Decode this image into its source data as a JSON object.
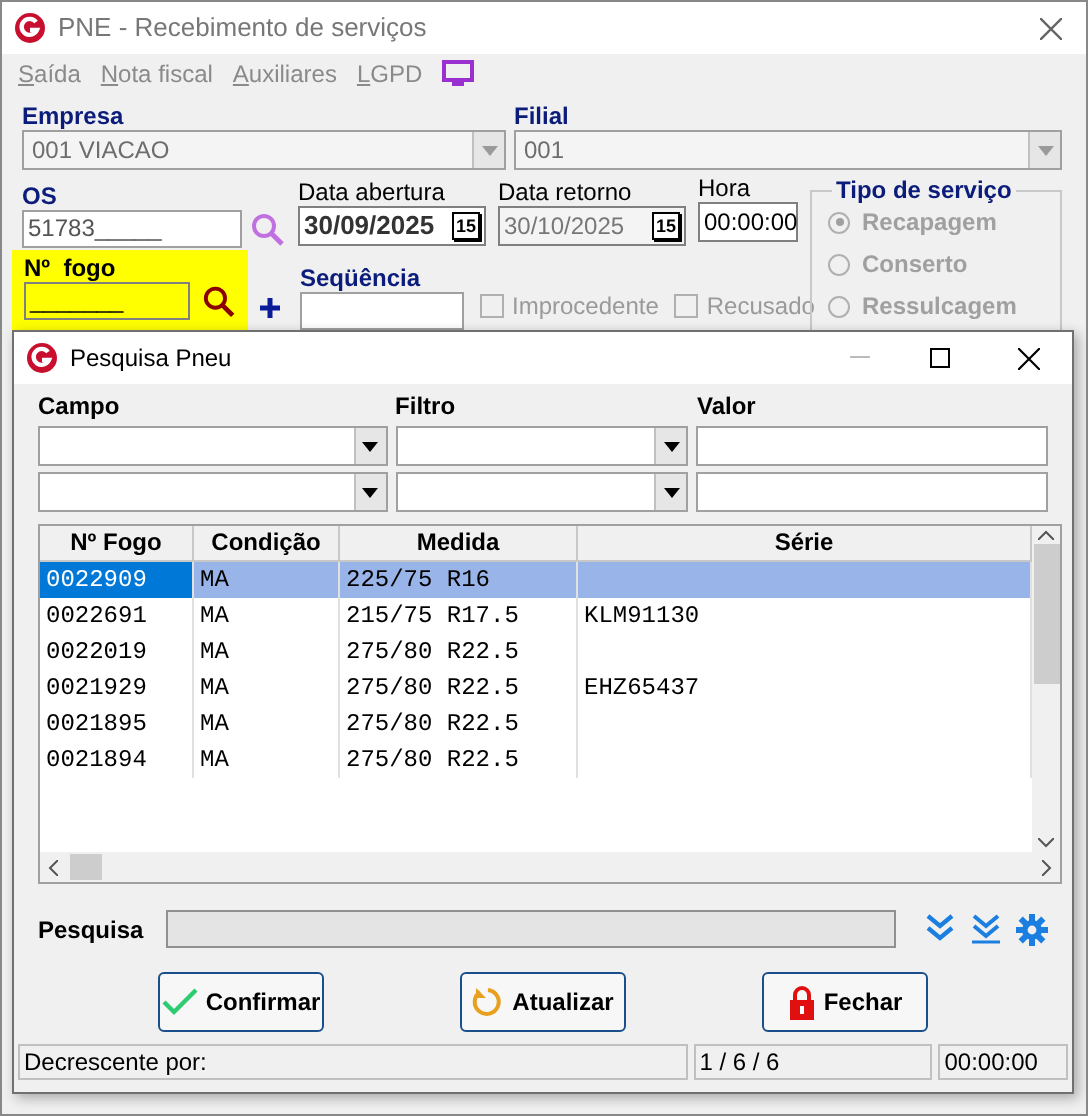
{
  "window": {
    "title": "PNE - Recebimento de serviços"
  },
  "menu": [
    {
      "label": "Saída",
      "disabled": true
    },
    {
      "label": "Nota fiscal",
      "disabled": true
    },
    {
      "label": "Auxiliares",
      "disabled": true
    },
    {
      "label": "LGPD",
      "disabled": true
    }
  ],
  "empresa": {
    "label": "Empresa",
    "value": "001 VIACAO"
  },
  "filial": {
    "label": "Filial",
    "value": "001"
  },
  "os": {
    "label": "OS",
    "value": "51783_____"
  },
  "data_abertura": {
    "label": "Data abertura",
    "value": "30/09/2025",
    "calendar": "15"
  },
  "data_retorno": {
    "label": "Data retorno",
    "value": "30/10/2025",
    "calendar": "15"
  },
  "hora": {
    "label": "Hora",
    "value": "00:00:00"
  },
  "tipo_servico": {
    "title": "Tipo de serviço",
    "options": [
      {
        "label": "Recapagem",
        "selected": true,
        "disabled": true
      },
      {
        "label": "Conserto",
        "selected": false,
        "disabled": true
      },
      {
        "label": "Ressulcagem",
        "selected": false,
        "disabled": true
      }
    ]
  },
  "n_fogo": {
    "label": "Nº  fogo",
    "value": "_______"
  },
  "sequencia": {
    "label": "Seqüência"
  },
  "checks": [
    {
      "label": "Improcedente",
      "checked": false,
      "disabled": true
    },
    {
      "label": "Recusado",
      "checked": false,
      "disabled": true
    }
  ],
  "dialog": {
    "title": "Pesquisa Pneu",
    "filter_labels": [
      "Campo",
      "Filtro",
      "Valor"
    ],
    "table": {
      "columns": [
        "Nº Fogo",
        "Condição",
        "Medida",
        "Série"
      ],
      "rows": [
        {
          "cells": [
            "0022909",
            "MA",
            "225/75 R16",
            ""
          ],
          "selected": true
        },
        {
          "cells": [
            "0022691",
            "MA",
            "215/75 R17.5",
            "KLM91130"
          ],
          "selected": false
        },
        {
          "cells": [
            "0022019",
            "MA",
            "275/80 R22.5",
            ""
          ],
          "selected": false
        },
        {
          "cells": [
            "0021929",
            "MA",
            "275/80 R22.5",
            "EHZ65437"
          ],
          "selected": false
        },
        {
          "cells": [
            "0021895",
            "MA",
            "275/80 R22.5",
            ""
          ],
          "selected": false
        },
        {
          "cells": [
            "0021894",
            "MA",
            "275/80 R22.5",
            ""
          ],
          "selected": false
        }
      ]
    },
    "search_label": "Pesquisa",
    "buttons": [
      {
        "kind": "confirm",
        "label": "Confirmar"
      },
      {
        "kind": "refresh",
        "label": "Atualizar"
      },
      {
        "kind": "close",
        "label": "Fechar"
      }
    ],
    "status": [
      "Decrescente por:",
      "1 / 6 / 6",
      "00:00:00"
    ]
  }
}
